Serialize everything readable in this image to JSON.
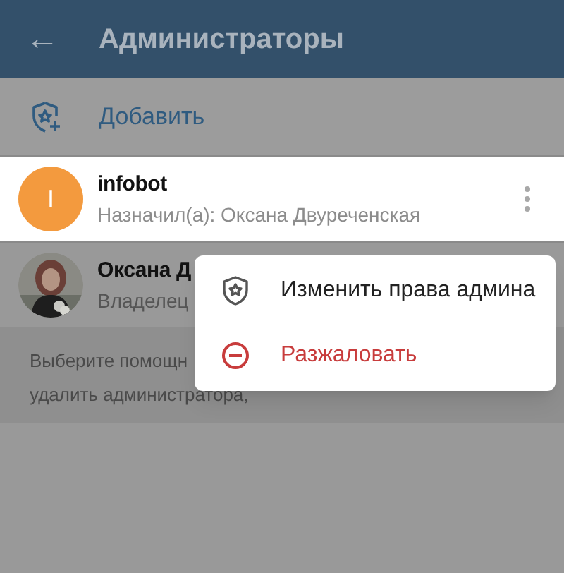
{
  "header": {
    "back": "←",
    "title": "Администраторы"
  },
  "add_row": {
    "label": "Добавить"
  },
  "admins": [
    {
      "name": "infobot",
      "subtitle": "Назначил(а): Оксана Двуреченская",
      "avatar": {
        "kind": "letter",
        "letter": "I",
        "color": "#f39a3e"
      },
      "selected": true,
      "menu_button": true
    },
    {
      "name": "Оксана Д",
      "subtitle": "Владелец",
      "selected": false,
      "menu_button": false
    }
  ],
  "hint_lines": [
    "Выберите помощн",
    "удалить администратора,"
  ],
  "context_menu": [
    {
      "kind": "normal",
      "label": "Изменить права админа"
    },
    {
      "kind": "danger",
      "label": "Разжаловать"
    }
  ]
}
